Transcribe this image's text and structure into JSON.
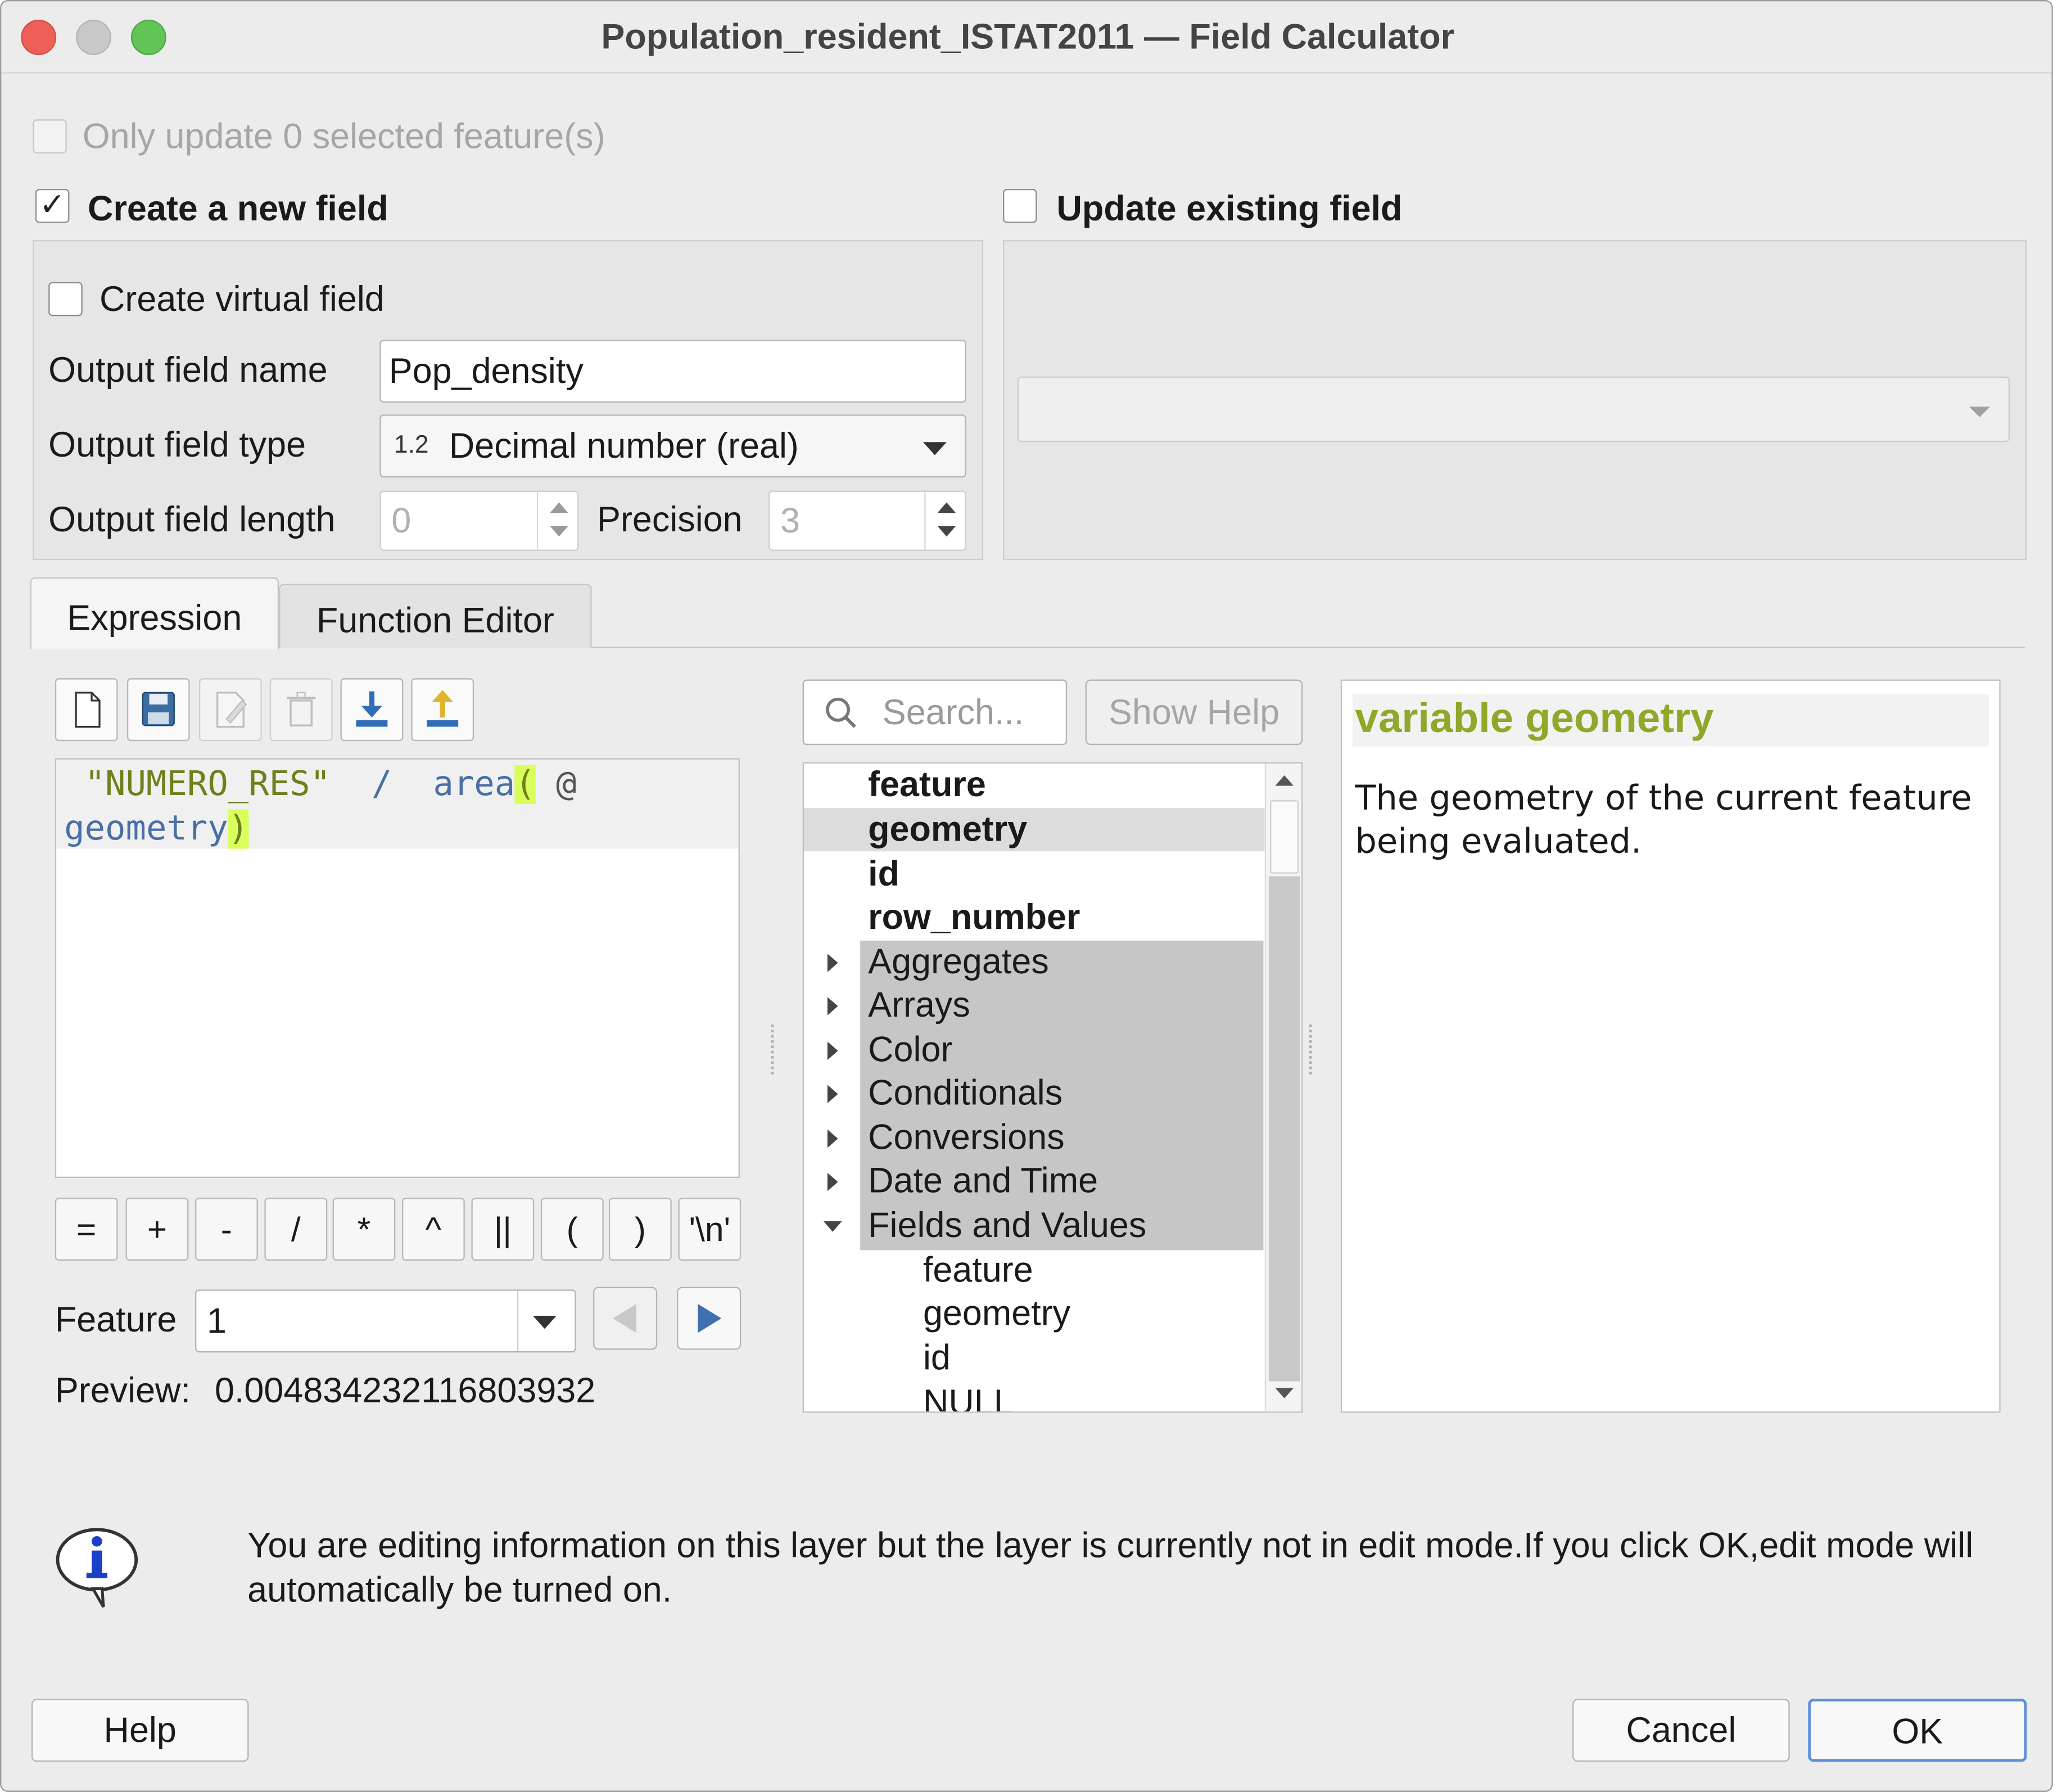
{
  "window": {
    "title": "Population_resident_ISTAT2011 — Field Calculator"
  },
  "top": {
    "only_update_label": "Only update 0 selected feature(s)",
    "create_new_label": "Create a new field",
    "create_new_checked_mark": "✓",
    "update_existing_label": "Update existing field"
  },
  "new_field": {
    "virtual_label": "Create virtual field",
    "name_label": "Output field name",
    "name_value": "Pop_density",
    "type_label": "Output field type",
    "type_badge": "1.2",
    "type_value": "Decimal number (real)",
    "length_label": "Output field length",
    "length_value": "0",
    "precision_label": "Precision",
    "precision_value": "3"
  },
  "tabs": [
    {
      "label": "Expression"
    },
    {
      "label": "Function Editor"
    }
  ],
  "expression": {
    "tokens": {
      "field": "\"NUMERO_RES\"",
      "op": "/",
      "func": "area",
      "open_paren": "(",
      "at": "@",
      "var": "geometry",
      "close_paren": ")"
    },
    "operators": [
      "=",
      "+",
      "-",
      "/",
      "*",
      "^",
      "||",
      "(",
      ")",
      "'\\n'"
    ],
    "feature_label": "Feature",
    "feature_value": "1",
    "preview_label": "Preview:",
    "preview_value": "0.004834232116803932"
  },
  "search": {
    "placeholder": "Search...",
    "show_help_label": "Show Help"
  },
  "tree": {
    "top_items": [
      "feature",
      "geometry",
      "id",
      "row_number"
    ],
    "groups": [
      "Aggregates",
      "Arrays",
      "Color",
      "Conditionals",
      "Conversions",
      "Date and Time",
      "Fields and Values"
    ],
    "children": [
      "feature",
      "geometry",
      "id",
      "NULL"
    ]
  },
  "help": {
    "title": "variable geometry",
    "body": "The geometry of the current feature being evaluated."
  },
  "info": {
    "message": "You are editing information on this layer but the layer is currently not in edit mode.If you click OK,edit mode will automatically be turned on."
  },
  "buttons": {
    "help": "Help",
    "cancel": "Cancel",
    "ok": "OK"
  },
  "colors": {
    "accent_help": "#8ea82a",
    "expr_field": "#6e7f1b",
    "expr_func": "#4a6fa5",
    "match_highlight": "#d8ff5c",
    "list_selected": "#c6c6c6"
  }
}
